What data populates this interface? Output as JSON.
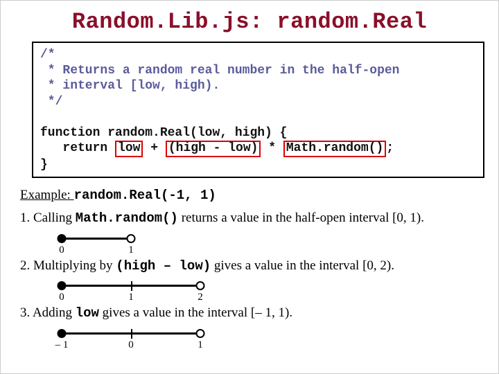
{
  "title": "Random.Lib.js: random.Real",
  "code": {
    "c1": "/*",
    "c2": " * Returns a random real number in the half-open",
    "c3": " * interval [low, high).",
    "c4": " */",
    "blank": "",
    "sig": "function random.Real(low, high) {",
    "ret_pre": "   return ",
    "ret_box1": "low",
    "ret_mid1": " + ",
    "ret_box2": "(high - low)",
    "ret_mid2": " * ",
    "ret_box3": "Math.random()",
    "ret_post": ";",
    "close": "}"
  },
  "example_label": "Example: ",
  "example_call": "random.Real(-1, 1)",
  "step1_pre": "1. Calling ",
  "step1_code": "Math.random()",
  "step1_post": " returns a value in the half-open interval [0, 1).",
  "step2_pre": "2. Multiplying by ",
  "step2_code": "(high – low)",
  "step2_post": " gives a value in the interval [0, 2).",
  "step3_pre": "3. Adding ",
  "step3_code": "low",
  "step3_post": " gives a value in the interval [– 1, 1).",
  "nl1": {
    "t0": "0",
    "t1": "1"
  },
  "nl2": {
    "t0": "0",
    "t1": "1",
    "t2": "2"
  },
  "nl3": {
    "t0": "– 1",
    "t1": "0",
    "t2": "1"
  }
}
